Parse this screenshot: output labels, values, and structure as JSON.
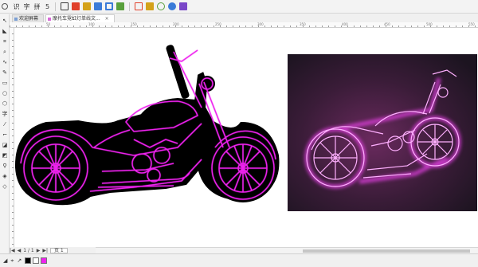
{
  "toolbar": {
    "menu_items": [
      "识",
      "字",
      "拼",
      "5"
    ],
    "icon_colors": [
      "#3a3a3a",
      "#e0402a",
      "#d4a21a",
      "#3b7bd8",
      "#3b7bd8",
      "#59a03c",
      "#e0402a",
      "#d4a21a",
      "#59a03c",
      "#3b7bd8",
      "#7a47c8"
    ]
  },
  "tabs": [
    {
      "label": "欢迎屏幕",
      "active": false
    },
    {
      "label": "摩托车霓虹灯单线文...",
      "active": true
    }
  ],
  "ruler": {
    "labels": [
      "50",
      "100",
      "150",
      "200",
      "250",
      "300",
      "350",
      "400",
      "450",
      "500",
      "550"
    ]
  },
  "page_nav": {
    "page_label": "页 1",
    "controls": [
      "|◀",
      "◀",
      "1 / 1",
      "▶",
      "▶|"
    ]
  },
  "colors": {
    "neon": "#ee22ee",
    "neon_glow": "#ff66ff",
    "fill": "#000000",
    "photo_bg": "#2a1a2c",
    "photo_bg_light": "#4a2240"
  },
  "status": {
    "icons": [
      "◢",
      "⌖",
      "↗"
    ],
    "swatches": [
      "#000000",
      "#ffffff",
      "#ee22ee"
    ]
  }
}
